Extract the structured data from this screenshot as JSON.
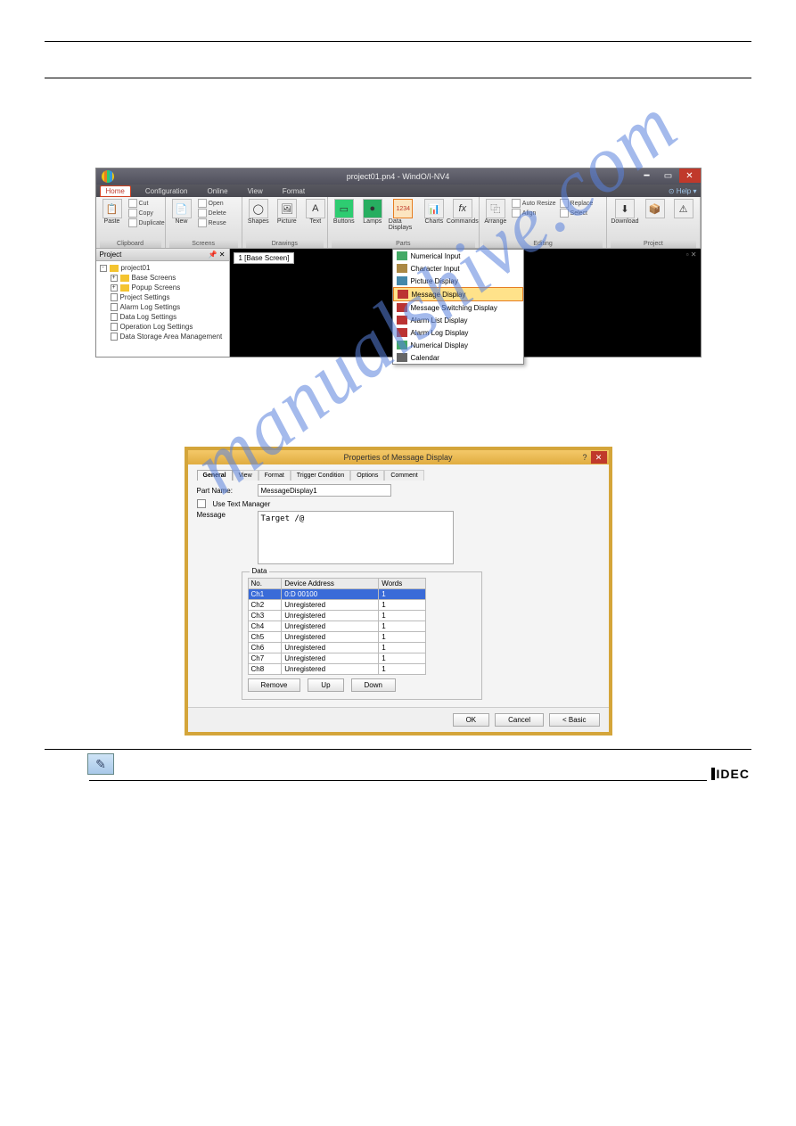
{
  "app": {
    "title": "project01.pn4 - WindO/I-NV4",
    "menus": [
      "Home",
      "Configuration",
      "Online",
      "View",
      "Format"
    ],
    "help": "⊙ Help ▾"
  },
  "ribbon": {
    "groups": {
      "clipboard": {
        "label": "Clipboard",
        "paste": "Paste",
        "cut": "Cut",
        "copy": "Copy",
        "dup": "Duplicate"
      },
      "screens": {
        "label": "Screens",
        "new": "New",
        "open": "Open",
        "delete": "Delete",
        "reuse": "Reuse"
      },
      "drawings": {
        "label": "Drawings",
        "shapes": "Shapes",
        "picture": "Picture",
        "text": "Text"
      },
      "parts": {
        "label": "Parts",
        "buttons": "Buttons",
        "lamps": "Lamps",
        "dataDisplays": "Data Displays",
        "charts": "Charts",
        "commands": "Commands"
      },
      "editing": {
        "label": "Editing",
        "arrange": "Arrange",
        "autoresize": "Auto Resize",
        "align": "Align",
        "replace": "Replace",
        "select": "Select"
      },
      "project": {
        "label": "Project",
        "download": "Download"
      }
    }
  },
  "dropdown": {
    "items": [
      "Numerical Input",
      "Character Input",
      "Picture Display",
      "Message Display",
      "Message Switching Display",
      "Alarm List Display",
      "Alarm Log Display",
      "Numerical Display",
      "Calendar"
    ]
  },
  "projectPanel": {
    "header": "Project",
    "root": "project01",
    "nodes": [
      "Base Screens",
      "Popup Screens",
      "Project Settings",
      "Alarm Log Settings",
      "Data Log Settings",
      "Operation Log Settings",
      "Data Storage Area Management"
    ]
  },
  "canvas": {
    "tab": "1 [Base Screen]"
  },
  "dialog": {
    "title": "Properties of Message Display",
    "tabs": [
      "General",
      "View",
      "Format",
      "Trigger Condition",
      "Options",
      "Comment"
    ],
    "partName": {
      "label": "Part Name:",
      "value": "MessageDisplay1"
    },
    "useTextMgr": "Use Text Manager",
    "messageLabel": "Message",
    "messageText": "Target  /@",
    "dataLegend": "Data",
    "cols": {
      "no": "No.",
      "addr": "Device Address",
      "words": "Words"
    },
    "rows": [
      {
        "no": "Ch1",
        "addr": "0:D 00100",
        "words": "1",
        "sel": true
      },
      {
        "no": "Ch2",
        "addr": "Unregistered",
        "words": "1"
      },
      {
        "no": "Ch3",
        "addr": "Unregistered",
        "words": "1"
      },
      {
        "no": "Ch4",
        "addr": "Unregistered",
        "words": "1"
      },
      {
        "no": "Ch5",
        "addr": "Unregistered",
        "words": "1"
      },
      {
        "no": "Ch6",
        "addr": "Unregistered",
        "words": "1"
      },
      {
        "no": "Ch7",
        "addr": "Unregistered",
        "words": "1"
      },
      {
        "no": "Ch8",
        "addr": "Unregistered",
        "words": "1"
      }
    ],
    "remove": "Remove",
    "up": "Up",
    "down": "Down",
    "ok": "OK",
    "cancel": "Cancel",
    "basic": "< Basic"
  },
  "watermark": "manualshive.com",
  "footer": "IDEC"
}
